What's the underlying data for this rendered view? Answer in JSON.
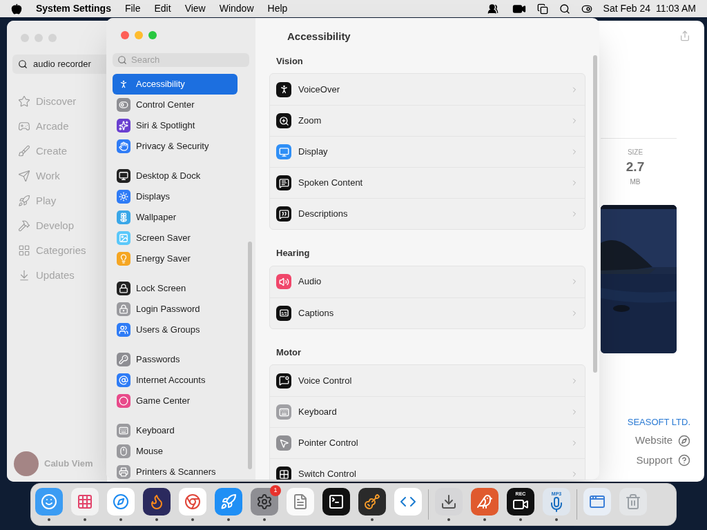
{
  "menu_bar": {
    "app_name": "System Settings",
    "menus": [
      "File",
      "Edit",
      "View",
      "Window",
      "Help"
    ],
    "clock": "Sat Feb 24  11:03 AM"
  },
  "app_store": {
    "search": {
      "value": "audio recorder"
    },
    "sidebar": [
      {
        "label": "Discover"
      },
      {
        "label": "Arcade"
      },
      {
        "label": "Create"
      },
      {
        "label": "Work"
      },
      {
        "label": "Play"
      },
      {
        "label": "Develop"
      },
      {
        "label": "Categories"
      },
      {
        "label": "Updates"
      }
    ],
    "user": "Calub Viem",
    "size": {
      "label": "SIZE",
      "value": "2.7",
      "unit": "MB"
    },
    "developer": "SEASOFT LTD.",
    "links": [
      "Website",
      "Support"
    ]
  },
  "settings": {
    "search": {
      "placeholder": "Search"
    },
    "sidebar_groups": [
      [
        {
          "label": "Accessibility",
          "selected": true
        },
        {
          "label": "Control Center",
          "selected": false
        },
        {
          "label": "Siri & Spotlight",
          "selected": false
        },
        {
          "label": "Privacy & Security",
          "selected": false
        }
      ],
      [
        {
          "label": "Desktop & Dock",
          "selected": false
        },
        {
          "label": "Displays",
          "selected": false
        },
        {
          "label": "Wallpaper",
          "selected": false
        },
        {
          "label": "Screen Saver",
          "selected": false
        },
        {
          "label": "Energy Saver",
          "selected": false
        }
      ],
      [
        {
          "label": "Lock Screen",
          "selected": false
        },
        {
          "label": "Login Password",
          "selected": false
        },
        {
          "label": "Users & Groups",
          "selected": false
        }
      ],
      [
        {
          "label": "Passwords",
          "selected": false
        },
        {
          "label": "Internet Accounts",
          "selected": false
        },
        {
          "label": "Game Center",
          "selected": false
        }
      ],
      [
        {
          "label": "Keyboard",
          "selected": false
        },
        {
          "label": "Mouse",
          "selected": false
        },
        {
          "label": "Printers & Scanners",
          "selected": false
        }
      ]
    ],
    "title": "Accessibility",
    "sections": [
      {
        "heading": "Vision",
        "rows": [
          "VoiceOver",
          "Zoom",
          "Display",
          "Spoken Content",
          "Descriptions"
        ]
      },
      {
        "heading": "Hearing",
        "rows": [
          "Audio",
          "Captions"
        ]
      },
      {
        "heading": "Motor",
        "rows": [
          "Voice Control",
          "Keyboard",
          "Pointer Control",
          "Switch Control"
        ]
      }
    ]
  },
  "dock": {
    "groups": [
      [
        {
          "running": true
        },
        {
          "running": true
        },
        {
          "running": true
        },
        {
          "running": true
        },
        {
          "running": true
        },
        {
          "running": true
        },
        {
          "running": true,
          "badge": "1"
        },
        {
          "running": false
        },
        {
          "running": false
        },
        {
          "running": true
        },
        {
          "running": false
        }
      ],
      [
        {
          "running": true
        },
        {
          "running": true
        },
        {
          "running": true,
          "text": "REC"
        },
        {
          "running": true,
          "text": "MP3"
        }
      ],
      [
        {
          "running": false
        },
        {
          "running": false
        }
      ]
    ]
  }
}
